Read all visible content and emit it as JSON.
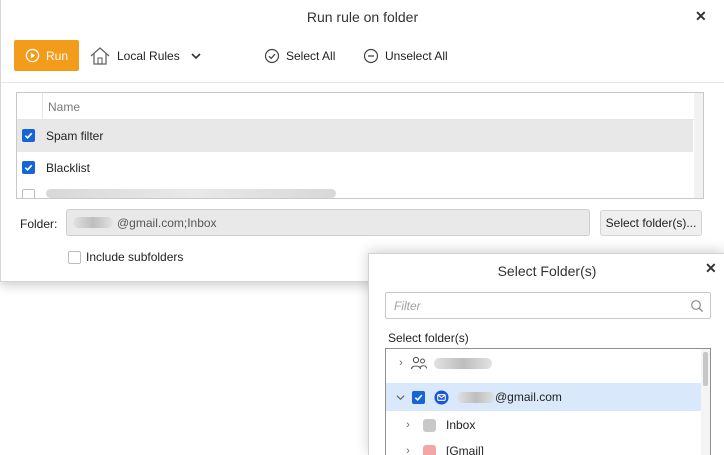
{
  "main_dialog": {
    "title": "Run rule on folder",
    "toolbar": {
      "run_label": "Run",
      "local_rules_label": "Local Rules",
      "select_all_label": "Select All",
      "unselect_all_label": "Unselect All"
    },
    "list": {
      "column_name": "Name",
      "rows": [
        {
          "label": "Spam filter",
          "checked": true,
          "selected": true
        },
        {
          "label": "Blacklist",
          "checked": true,
          "selected": false
        }
      ]
    },
    "folder": {
      "label": "Folder:",
      "value_suffix": "@gmail.com;Inbox",
      "select_button_label": "Select folder(s)..."
    },
    "include_subfolders_label": "Include subfolders"
  },
  "select_dialog": {
    "title": "Select Folder(s)",
    "filter_placeholder": "Filter",
    "section_label": "Select folder(s)",
    "tree": {
      "account_suffix": "@gmail.com",
      "folders": [
        {
          "label": "Inbox",
          "color": "#c8c8c8"
        },
        {
          "label": "[Gmail]",
          "color": "#f4a6a6"
        }
      ]
    }
  },
  "colors": {
    "accent_orange": "#f39b1a",
    "checkbox_blue": "#1565d8",
    "highlight_row": "#d9e8fb"
  }
}
